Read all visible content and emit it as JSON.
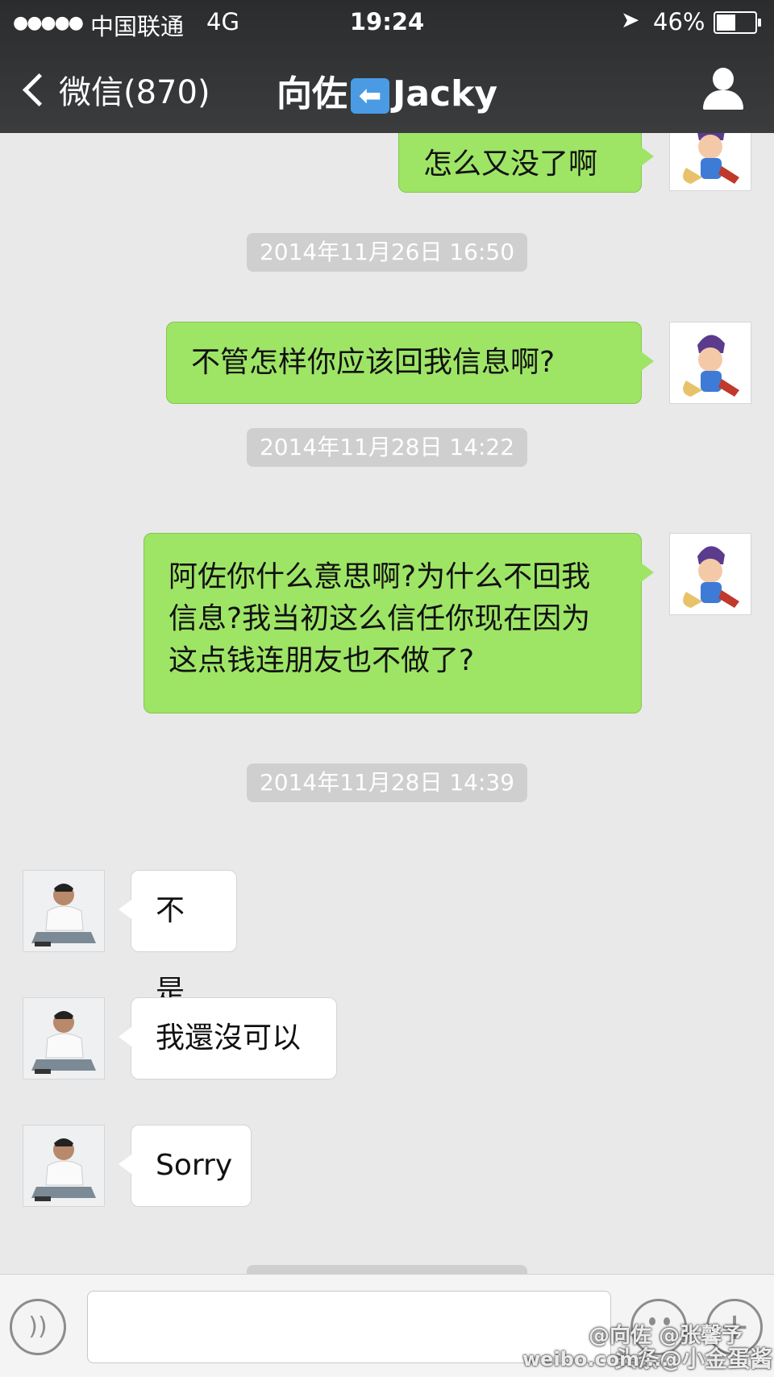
{
  "status_bar": {
    "signal": "●●●●●",
    "carrier": "中国联通",
    "network": "4G",
    "time": "19:24",
    "battery_percent": "46%",
    "battery_level": 0.46
  },
  "nav": {
    "back_label": "微信(870)",
    "title_prefix": "向佐",
    "title_emoji": "⬅",
    "title_suffix": "Jacky"
  },
  "messages": [
    {
      "type": "out",
      "text": "怎么又没了啊"
    },
    {
      "type": "timestamp",
      "text": "2014年11月26日 16:50"
    },
    {
      "type": "out",
      "text": "不管怎样你应该回我信息啊?"
    },
    {
      "type": "timestamp",
      "text": "2014年11月28日 14:22"
    },
    {
      "type": "out",
      "text": "阿佐你什么意思啊?为什么不回我信息?我当初这么信任你现在因为这点钱连朋友也不做了?"
    },
    {
      "type": "timestamp",
      "text": "2014年11月28日 14:39"
    },
    {
      "type": "in",
      "text": "不是"
    },
    {
      "type": "in",
      "text": "我還沒可以"
    },
    {
      "type": "in",
      "text": "Sorry"
    }
  ],
  "watermarks": {
    "w1": "@向佐 @张馨予",
    "w2": "头条@小金蛋酱",
    "w3": "weibo.com/..."
  }
}
